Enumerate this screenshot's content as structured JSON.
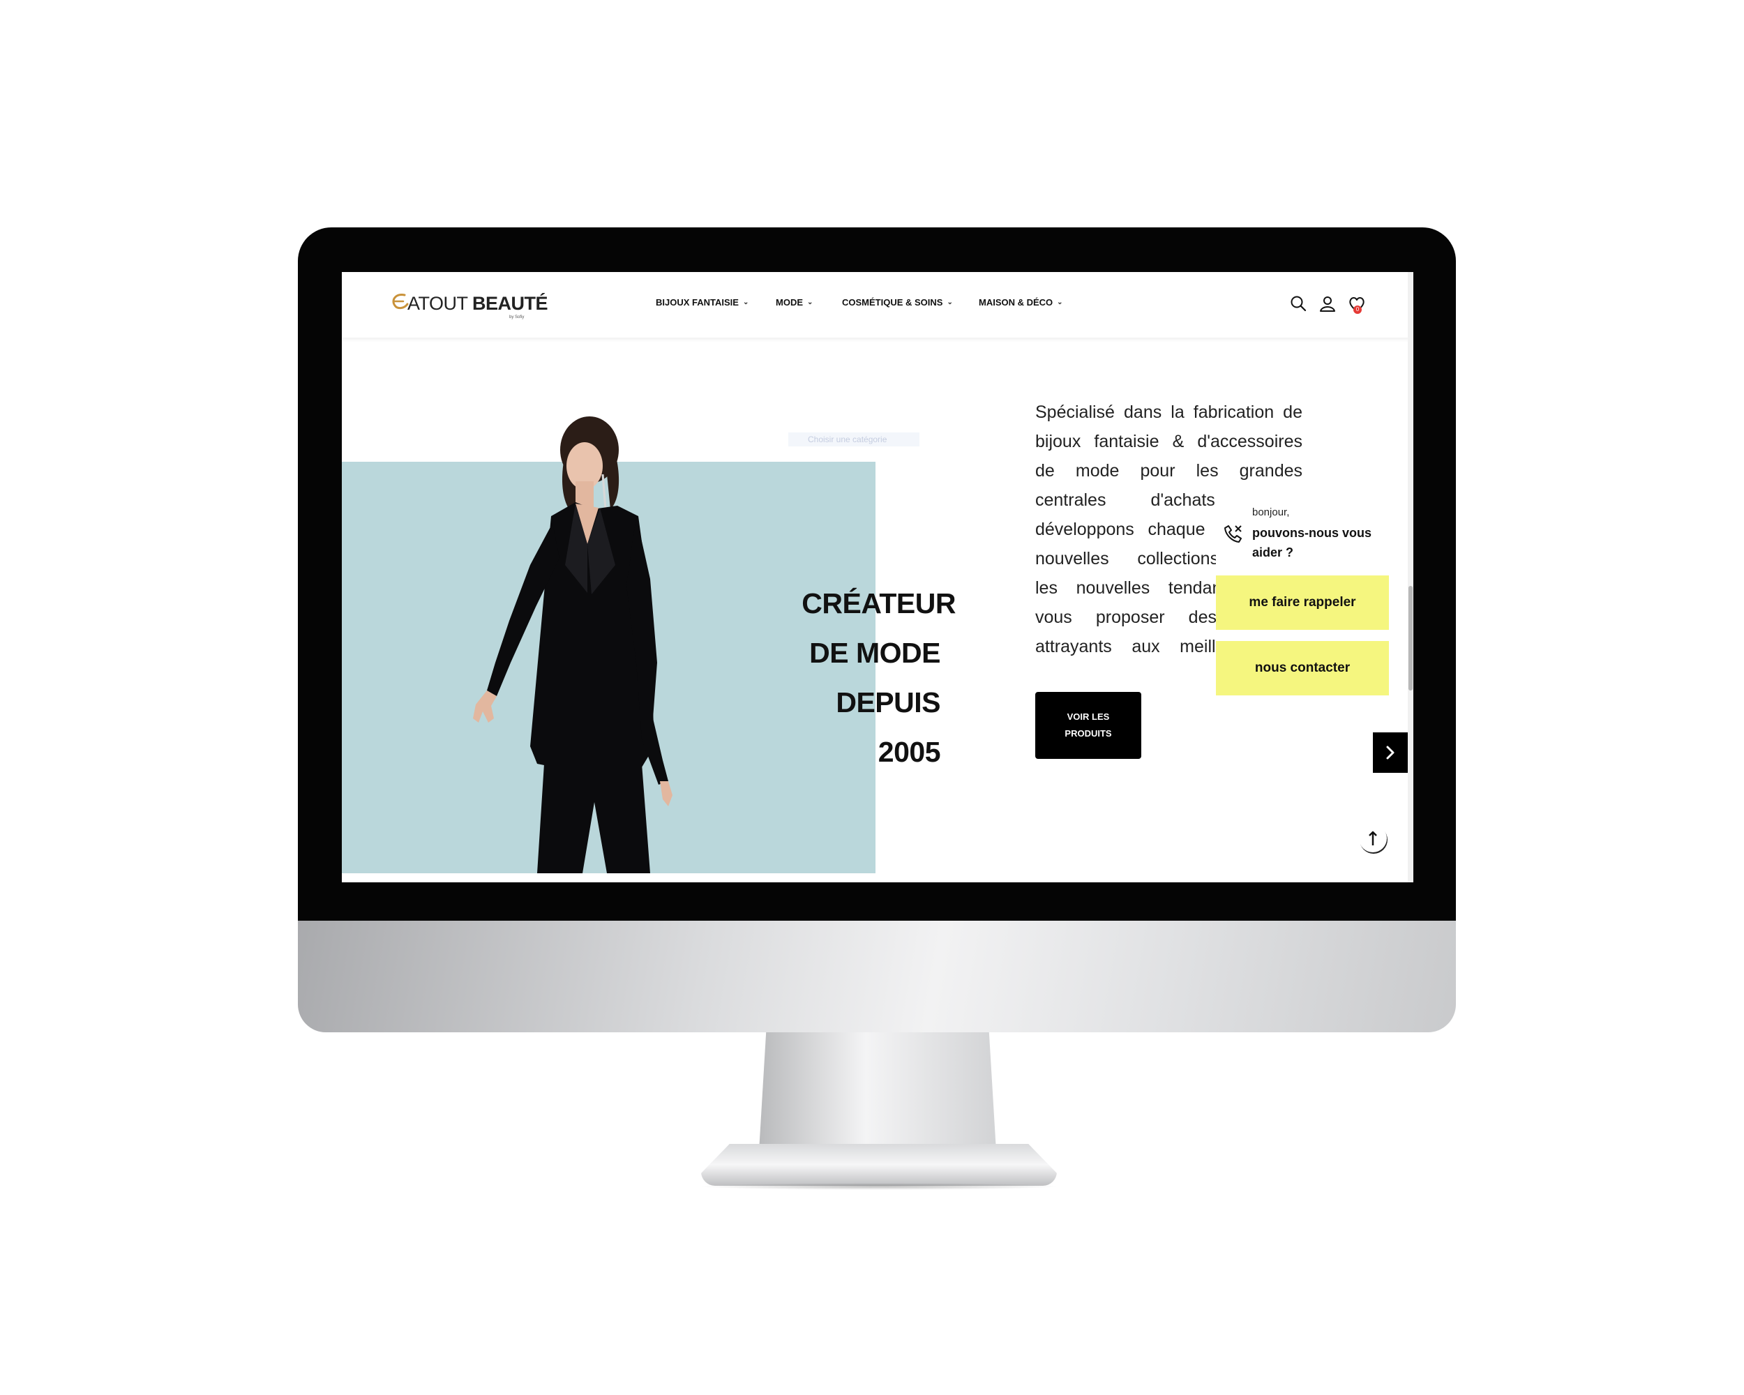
{
  "brand": {
    "name_light": "ATOUT",
    "name_bold": "BEAUTÉ",
    "sub": "by Sofiy",
    "accent": "#c9923a"
  },
  "nav": {
    "items": [
      {
        "label": "BIJOUX FANTAISIE"
      },
      {
        "label": "MODE"
      },
      {
        "label": "COSMÉTIQUE & SOINS"
      },
      {
        "label": "MAISON & DÉCO"
      }
    ]
  },
  "header_icons": {
    "search": "search-icon",
    "account": "user-icon",
    "wishlist": "heart-icon",
    "wishlist_count": "0"
  },
  "hero": {
    "title_lines": [
      "CRÉATEUR",
      "DE MODE",
      "DEPUIS",
      "2005"
    ],
    "category_pill": "Choisir une catégorie",
    "description_lines": [
      "Spécialisé dans la fabrication de",
      "bijoux fantaisie & d'accessoires",
      "de mode pour les grandes",
      "centrales d'achats, nous",
      "développons chaque saison de",
      "nouvelles collections suivant",
      "les nouvelles tendances pour",
      "vous proposer des produits",
      "attrayants aux meilleurs prix."
    ],
    "cta_line1": "VOIR LES",
    "cta_line2": "PRODUITS",
    "bg_color": "#bad7db"
  },
  "help_widget": {
    "greeting": "bonjour,",
    "question": "pouvons-nous vous aider ?",
    "callback_label": "me faire rappeler",
    "contact_label": "nous contacter",
    "button_color": "#f5f67f"
  }
}
